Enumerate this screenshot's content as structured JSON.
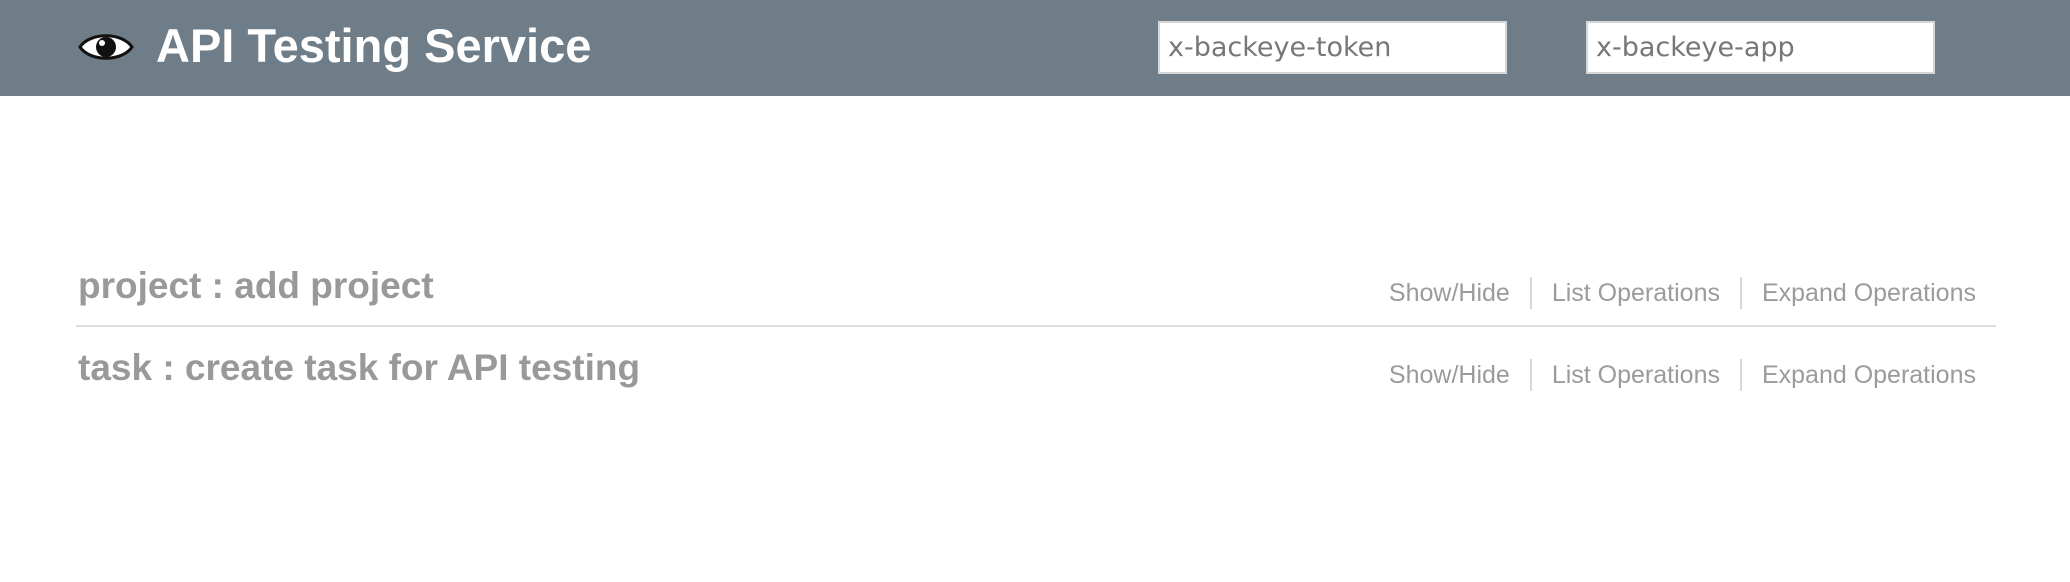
{
  "header": {
    "title": "API Testing Service",
    "logo_icon": "eye-icon",
    "background_color": "#6e7d87",
    "token_input": {
      "placeholder": "x-backeye-token",
      "value": ""
    },
    "app_input": {
      "placeholder": "x-backeye-app",
      "value": ""
    }
  },
  "resources": [
    {
      "title": "project : add project",
      "operations": {
        "show_hide": "Show/Hide",
        "list": "List Operations",
        "expand": "Expand Operations"
      }
    },
    {
      "title": "task : create task for API testing",
      "operations": {
        "show_hide": "Show/Hide",
        "list": "List Operations",
        "expand": "Expand Operations"
      }
    }
  ]
}
